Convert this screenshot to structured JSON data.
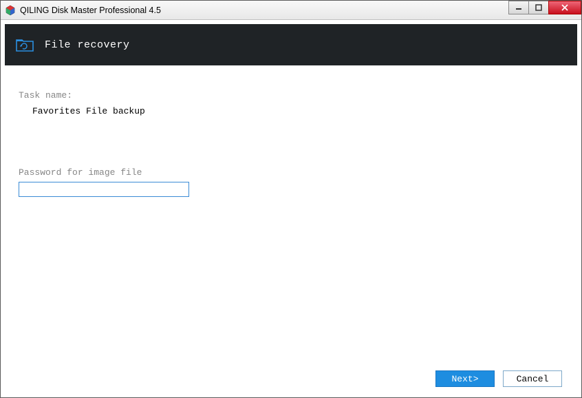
{
  "titlebar": {
    "title": "QILING Disk Master Professional 4.5"
  },
  "header": {
    "title": "File recovery"
  },
  "content": {
    "task_label": "Task name:",
    "task_value": "Favorites File backup",
    "password_label": "Password for image file",
    "password_value": ""
  },
  "footer": {
    "next_label": "Next>",
    "cancel_label": "Cancel"
  }
}
